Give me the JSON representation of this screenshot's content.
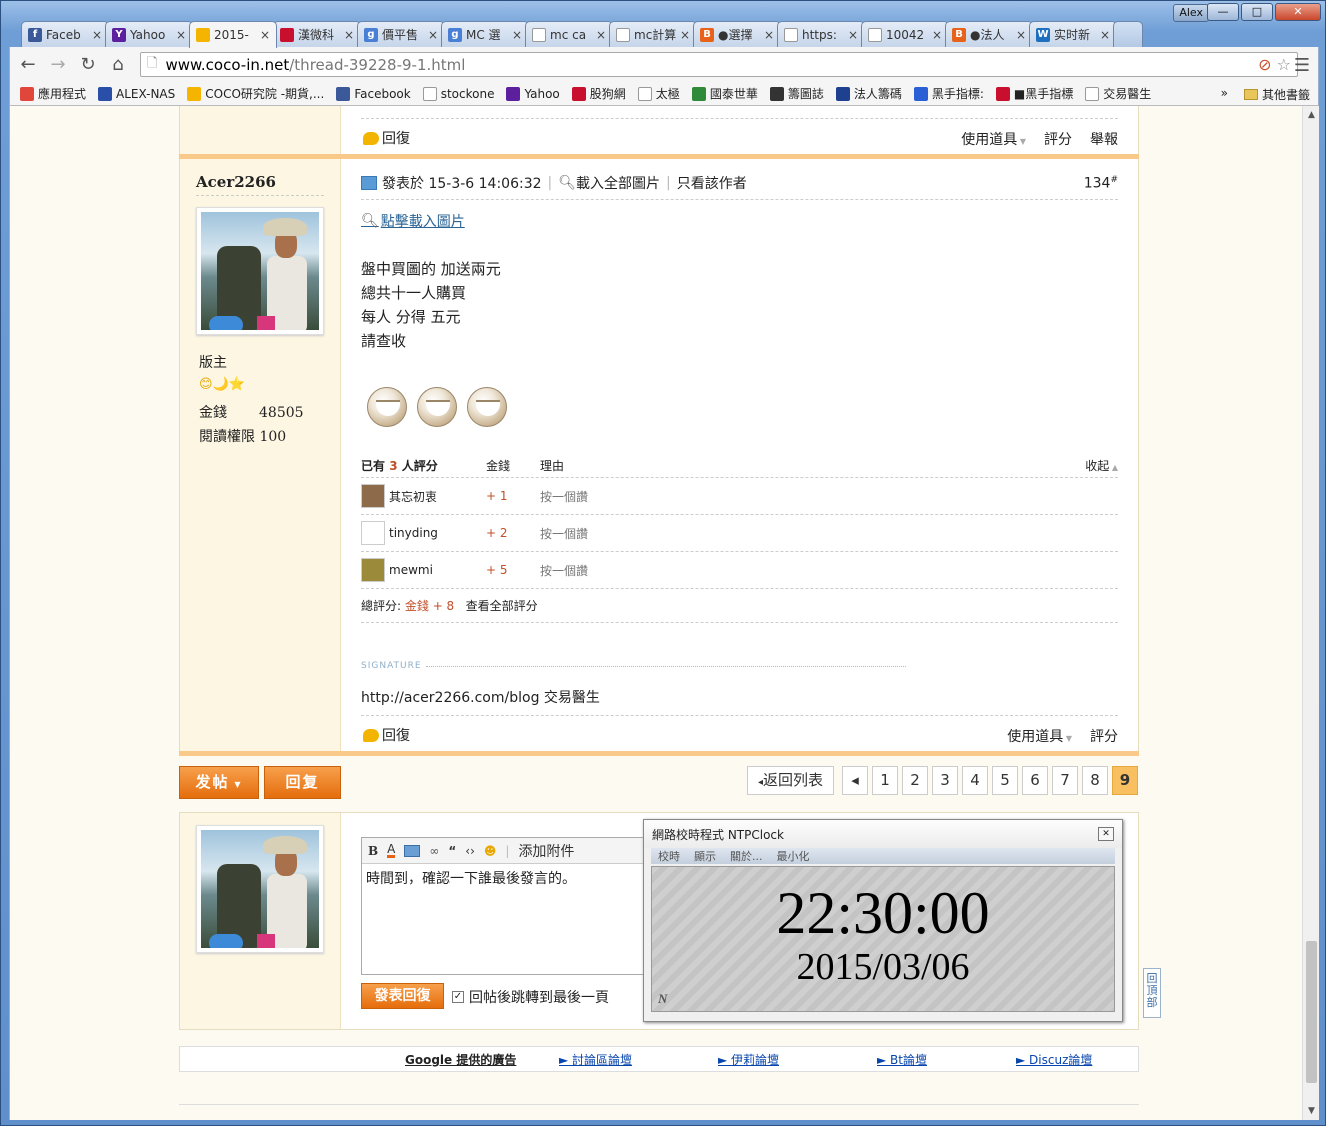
{
  "window": {
    "user": "Alex",
    "min": "—",
    "max": "□",
    "close": "✕"
  },
  "tabs": [
    {
      "label": "Faceb",
      "fav_color": "#3b5998",
      "fav": "f"
    },
    {
      "label": "Yahoo",
      "fav_color": "#5c1f9e",
      "fav": "Y"
    },
    {
      "label": "2015-",
      "fav_color": "#f5b400",
      "fav": "",
      "active": true
    },
    {
      "label": "漢微科",
      "fav_color": "#c8102e",
      "fav": ""
    },
    {
      "label": "價平售",
      "fav_color": "#4a7fd6",
      "fav": "g"
    },
    {
      "label": "MC 選",
      "fav_color": "#4a7fd6",
      "fav": "g"
    },
    {
      "label": "mc ca",
      "fav_color": "#ffffff",
      "fav": ""
    },
    {
      "label": "mc計算",
      "fav_color": "#ffffff",
      "fav": ""
    },
    {
      "label": "●選擇",
      "fav_color": "#e8631a",
      "fav": "B"
    },
    {
      "label": "https:",
      "fav_color": "#ffffff",
      "fav": ""
    },
    {
      "label": "10042",
      "fav_color": "#ffffff",
      "fav": ""
    },
    {
      "label": "●法人",
      "fav_color": "#e8631a",
      "fav": "B"
    },
    {
      "label": "实时新",
      "fav_color": "#1f6fbf",
      "fav": "W"
    }
  ],
  "tab_close": "×",
  "address": {
    "host": "www.coco-in.net",
    "path": "/thread-39228-9-1.html"
  },
  "bookmarks": [
    {
      "label": "應用程式",
      "color": "#e0463a"
    },
    {
      "label": "ALEX-NAS",
      "color": "#2a4fa8"
    },
    {
      "label": "COCO研究院 -期貨,...",
      "color": "#f5b400"
    },
    {
      "label": "Facebook",
      "color": "#3b5998"
    },
    {
      "label": "stockone",
      "color": "#ffffff"
    },
    {
      "label": "Yahoo",
      "color": "#5c1f9e"
    },
    {
      "label": "股狗網",
      "color": "#c8102e"
    },
    {
      "label": "太極",
      "color": "#ffffff"
    },
    {
      "label": "國泰世華",
      "color": "#2f8a3a"
    },
    {
      "label": "籌圖誌",
      "color": "#333333"
    },
    {
      "label": "法人籌碼",
      "color": "#1f3f8f"
    },
    {
      "label": "黑手指標:",
      "color": "#2a5fd6"
    },
    {
      "label": "■黑手指標",
      "color": "#c8102e"
    },
    {
      "label": "交易醫生",
      "color": "#ffffff"
    }
  ],
  "bookmarks_more": "»",
  "bookmarks_other": "其他書籤",
  "top_post": {
    "reply": "回復",
    "tools": "使用道具",
    "rate": "評分",
    "report": "舉報"
  },
  "post": {
    "author": "Acer2266",
    "role": "版主",
    "stars": "😊🌙⭐",
    "money_label": "金錢",
    "money_value": "48505",
    "read_perm": "閱讀權限 100",
    "posted_at": "發表於 15-3-6 14:06:32",
    "load_all": "載入全部圖片",
    "author_only": "只看該作者",
    "floor": "134",
    "floor_mark": "#",
    "click_load": "點擊載入圖片",
    "lines": [
      "盤中買圖的 加送兩元",
      "總共十一人購買",
      "每人 分得 五元",
      "請查收"
    ],
    "rate_header": {
      "count_prefix": "已有",
      "count": "3",
      "count_suffix": "人評分",
      "col_money": "金錢",
      "col_reason": "理由",
      "collapse": "收起"
    },
    "ratings": [
      {
        "user": "其忘初衷",
        "value": "+ 1",
        "reason": "按一個讚"
      },
      {
        "user": "tinyding",
        "value": "+ 2",
        "reason": "按一個讚"
      },
      {
        "user": "mewmi",
        "value": "+ 5",
        "reason": "按一個讚"
      }
    ],
    "total_label": "總評分:",
    "total_value": "金錢 + 8",
    "view_all": "查看全部評分",
    "signature_label": "SIGNATURE",
    "signature": "http://acer2266.com/blog  交易醫生",
    "reply": "回復",
    "tools": "使用道具",
    "rate": "評分"
  },
  "actions": {
    "new_post": "发帖",
    "reply": "回复"
  },
  "pager": {
    "back": "返回列表",
    "prev": "◂",
    "pages": [
      "1",
      "2",
      "3",
      "4",
      "5",
      "6",
      "7",
      "8",
      "9"
    ],
    "current": "9"
  },
  "editor": {
    "attach": "添加附件",
    "content": "時間到，確認一下誰最後發言的。",
    "submit": "發表回復",
    "jump_label": "回帖後跳轉到最後一頁",
    "jump_checked": true
  },
  "ntp": {
    "title": "網路校時程式 NTPClock",
    "menu": [
      "校時",
      "顯示",
      "關於...",
      "最小化"
    ],
    "time": "22:30:00",
    "date": "2015/03/06",
    "logo": "N"
  },
  "backtop": "回頂部",
  "ads": {
    "label": "Google 提供的廣告",
    "links": [
      "► 討論區論壇",
      "► 伊莉論壇",
      "► Bt論壇",
      "► Discuz論壇"
    ]
  }
}
